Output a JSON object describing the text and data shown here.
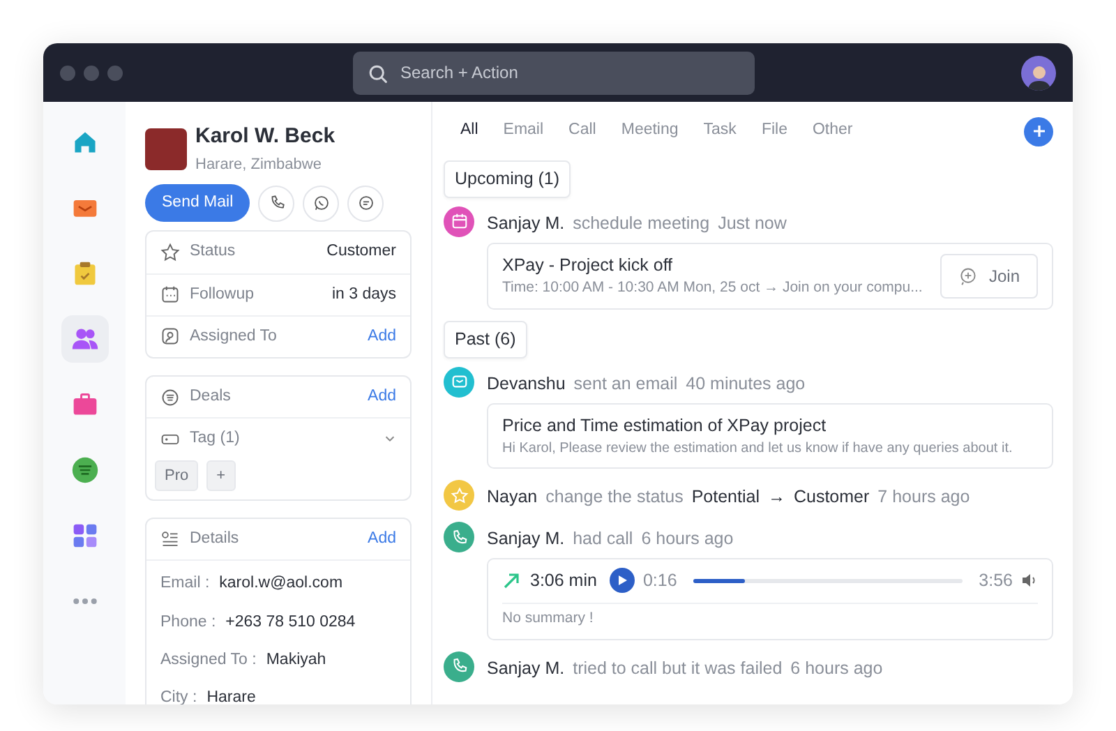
{
  "top_bar": {
    "search": {
      "placeholder": "Search + Action"
    }
  },
  "rail": [
    {
      "kind": "home",
      "selected": false
    },
    {
      "kind": "mail",
      "selected": false
    },
    {
      "kind": "tasks",
      "selected": false
    },
    {
      "kind": "contacts",
      "selected": true
    },
    {
      "kind": "briefcase",
      "selected": false
    },
    {
      "kind": "notes",
      "selected": false
    },
    {
      "kind": "apps",
      "selected": false
    },
    {
      "kind": "more",
      "selected": false
    }
  ],
  "contact": {
    "name": "Karol W. Beck",
    "location": "Harare, Zimbabwe",
    "send_button": "Send Mail",
    "actions": [
      {
        "kind": "phone"
      },
      {
        "kind": "whatsapp"
      },
      {
        "kind": "chat"
      }
    ],
    "info": [
      {
        "kind": "status",
        "label": "Status",
        "value": "Customer"
      },
      {
        "kind": "followup",
        "label": "Followup",
        "value": "in 3 days"
      },
      {
        "kind": "assignee",
        "label": "Assigned To",
        "value": "Add"
      }
    ],
    "deals": {
      "label": "Deals",
      "action": "Add"
    },
    "tag": {
      "label": "Tag (1)",
      "tags": [
        "Pro"
      ],
      "add": "+"
    },
    "details": {
      "label": "Details",
      "action": "Add",
      "fields": [
        {
          "label": "Email :",
          "value": "karol.w@aol.com"
        },
        {
          "label": "Phone :",
          "value": "+263 78 510 0284"
        },
        {
          "label": "Assigned To :",
          "value": "Makiyah"
        },
        {
          "label": "City :",
          "value": "Harare"
        }
      ]
    }
  },
  "activity": {
    "tabs": [
      {
        "label": "All",
        "selected": true
      },
      {
        "label": "Email",
        "selected": false
      },
      {
        "label": "Call",
        "selected": false
      },
      {
        "label": "Meeting",
        "selected": false
      },
      {
        "label": "Task",
        "selected": false
      },
      {
        "label": "File",
        "selected": false
      },
      {
        "label": "Other",
        "selected": false
      }
    ],
    "sections": [
      {
        "title": "Upcoming (1)",
        "items": [
          {
            "kind": "meeting",
            "color": "#e052b8",
            "author": "Sanjay M.",
            "action": "schedule meeting",
            "time": "Just now",
            "title": "XPay - Project kick off",
            "subtitle": "Time: 10:00 AM - 10:30 AM Mon, 25 oct → Join on your compu...",
            "button": "Join"
          }
        ]
      },
      {
        "title": "Past (6)",
        "items": [
          {
            "kind": "email",
            "color": "#22bfd0",
            "author": "Devanshu",
            "action": "sent an email",
            "time": "40 minutes ago",
            "title": "Price and Time estimation of XPay project",
            "subtitle": "Hi Karol, Please review the estimation and let us know if have any queries about it."
          },
          {
            "kind": "status",
            "color": "#f2c744",
            "author": "Nayan",
            "action": "change the status",
            "from": "Potential",
            "arrow": "→",
            "to": "Customer",
            "time": "7 hours ago"
          },
          {
            "kind": "call",
            "color": "#3aae8c",
            "author": "Sanjay M.",
            "action": "had call",
            "time": "6 hours ago",
            "duration": "3:06 min",
            "elapsed": "0:16",
            "level": 0.19,
            "total": "3:56",
            "summary": "No summary !"
          },
          {
            "kind": "plain",
            "color": "#3aae8c",
            "author": "Sanjay M.",
            "action": "tried to call but it was failed",
            "time": "6 hours ago"
          }
        ]
      }
    ]
  }
}
